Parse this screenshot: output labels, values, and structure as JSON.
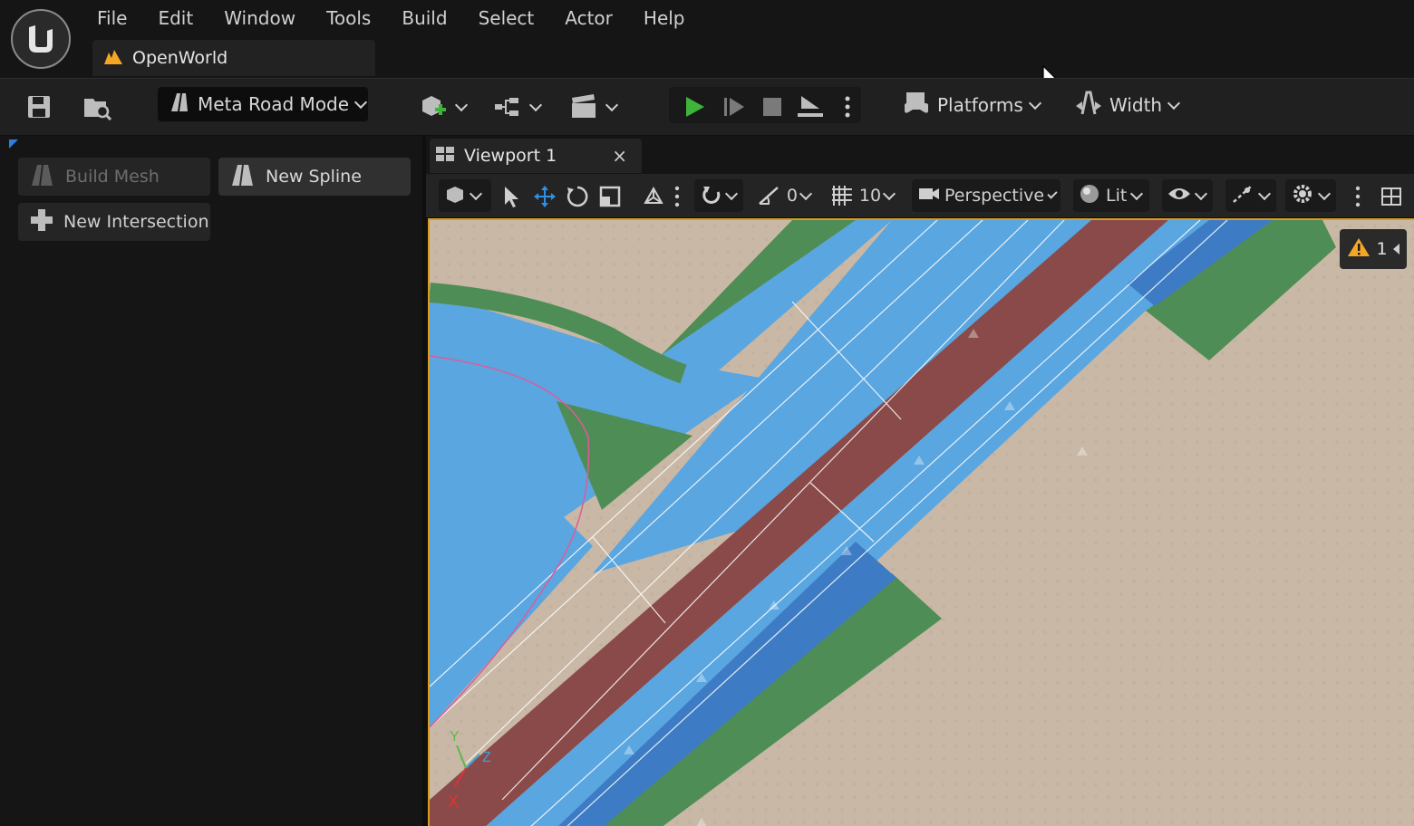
{
  "menu": [
    "File",
    "Edit",
    "Window",
    "Tools",
    "Build",
    "Select",
    "Actor",
    "Help"
  ],
  "document_tab": {
    "title": "OpenWorld"
  },
  "toolbar": {
    "mode_label": "Meta Road Mode",
    "platforms_label": "Platforms",
    "width_label": "Width"
  },
  "panel": {
    "build_mesh": "Build Mesh",
    "new_spline": "New Spline",
    "new_intersection": "New Intersection"
  },
  "viewport": {
    "tab_label": "Viewport 1",
    "close_glyph": "×",
    "rotation_snap": "0",
    "grid_snap": "10",
    "view_mode": "Perspective",
    "lighting": "Lit",
    "warning_count": "1"
  },
  "axes": {
    "x": "X",
    "y": "Y",
    "z": "Z"
  },
  "colors": {
    "accent_play": "#3fb43b",
    "viewport_border": "#d99c1f",
    "road_lane": "#5aa6e0",
    "road_median": "#8a4a4a",
    "shoulder_green": "#4f8d56",
    "ground": "#c9b8a6"
  }
}
